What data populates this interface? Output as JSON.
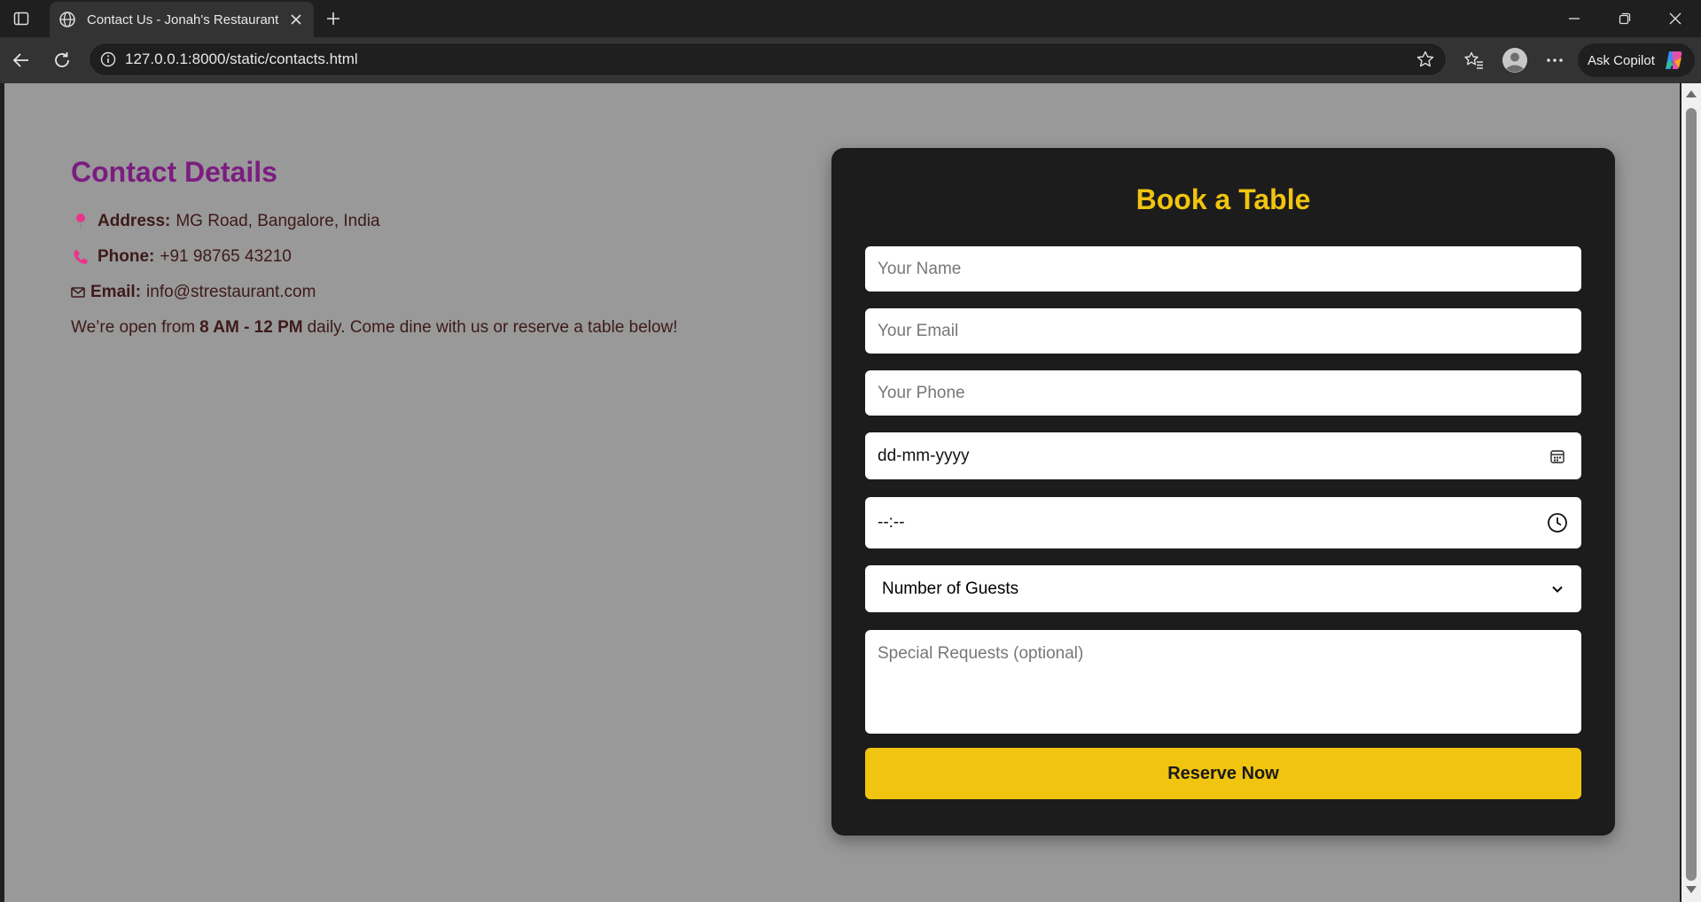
{
  "browser": {
    "tab_title": "Contact Us - Jonah's Restaurant",
    "url": "127.0.0.1:8000/static/contacts.html",
    "copilot_label": "Ask Copilot",
    "icons": [
      "sidebar-toggle-icon",
      "globe-icon",
      "close-icon",
      "plus-icon",
      "minimize-icon",
      "restore-icon",
      "window-close-icon",
      "back-arrow-icon",
      "reload-icon",
      "info-icon",
      "star-icon",
      "favorites-icon",
      "profile-icon",
      "more-icon",
      "copilot-icon"
    ]
  },
  "contact": {
    "heading": "Contact Details",
    "address_label": "Address:",
    "address_value": "MG Road, Bangalore, India",
    "phone_label": "Phone:",
    "phone_value": "+91 98765 43210",
    "email_label": "Email:",
    "email_value": "info@strestaurant.com",
    "hours_prefix": "We’re open from",
    "hours_bold": "8 AM - 12 PM",
    "hours_suffix": "daily. Come dine with us or reserve a table below!"
  },
  "booking": {
    "heading": "Book a Table",
    "name_placeholder": "Your Name",
    "email_placeholder": "Your Email",
    "phone_placeholder": "Your Phone",
    "date_value": "dd-mm-yyyy",
    "time_value": "--:--",
    "guests_selected": "Number of Guests",
    "requests_placeholder": "Special Requests (optional)",
    "submit_label": "Reserve Now"
  },
  "colors": {
    "page_background": "#999999",
    "heading_purple": "#7b1d80",
    "card_background": "#1c1c1c",
    "accent_yellow": "#f1c40f",
    "icon_pink": "#e8358a"
  }
}
